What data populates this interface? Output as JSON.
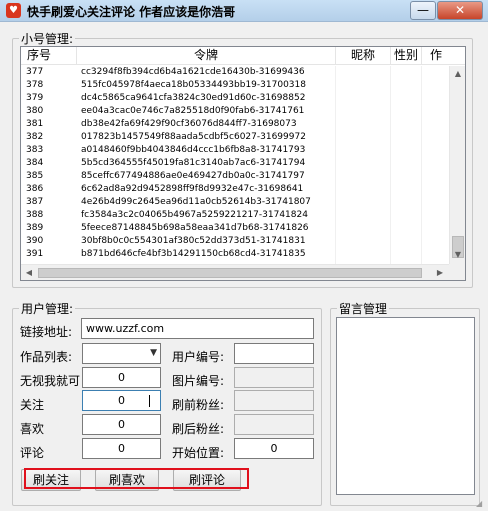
{
  "window": {
    "title": "快手刷爱心关注评论 作者应该是你浩哥",
    "minimize_glyph": "—",
    "close_glyph": "✕"
  },
  "accounts": {
    "group_title": "小号管理:",
    "columns": [
      "序号",
      "令牌",
      "昵称",
      "性别",
      "作"
    ],
    "rows": [
      {
        "id": "377",
        "token": "cc3294f8fb394cd6b4a1621cde16430b-31699436"
      },
      {
        "id": "378",
        "token": "515fc045978f4aeca18b05334493bb19-31700318"
      },
      {
        "id": "379",
        "token": "dc4c5865ca9641cfa3824c30ed91d60c-31698852"
      },
      {
        "id": "380",
        "token": "ee04a3cac0e746c7a825518d0f90fab6-31741761"
      },
      {
        "id": "381",
        "token": "db38e42fa69f429f90cf36076d844ff7-31698073"
      },
      {
        "id": "382",
        "token": "017823b1457549f88aada5cdbf5c6027-31699972"
      },
      {
        "id": "383",
        "token": "a0148460f9bb4043846d4ccc1b6fb8a8-31741793"
      },
      {
        "id": "384",
        "token": "5b5cd364555f45019fa81c3140ab7ac6-31741794"
      },
      {
        "id": "385",
        "token": "85ceffc677494886ae0e469427db0a0c-31741797"
      },
      {
        "id": "386",
        "token": "6c62ad8a92d9452898ff9f8d9932e47c-31698641"
      },
      {
        "id": "387",
        "token": "4e26b4d99c2645ea96d11a0cb52614b3-31741807"
      },
      {
        "id": "388",
        "token": "fc3584a3c2c04065b4967a5259221217-31741824"
      },
      {
        "id": "389",
        "token": "5feece87148845b698a58eaa341d7b68-31741826"
      },
      {
        "id": "390",
        "token": "30bf8b0c0c554301af380c52dd373d51-31741831"
      },
      {
        "id": "391",
        "token": "b871bd646cfe4bf3b14291150cb68cd4-31741835"
      }
    ]
  },
  "users": {
    "group_title": "用户管理:",
    "url_label": "链接地址:",
    "url_value": "www.uzzf.com",
    "works_label": "作品列表:",
    "user_no_label": "用户编号:",
    "ignore_label": "无视我就可",
    "ignore_value": "0",
    "pic_no_label": "图片编号:",
    "follow_label": "关注",
    "follow_value": "0",
    "fans_before_label": "刷前粉丝:",
    "like_label": "喜欢",
    "like_value": "0",
    "fans_after_label": "刷后粉丝:",
    "comment_label": "评论",
    "comment_value": "0",
    "start_label": "开始位置:",
    "start_value": "0",
    "buttons": {
      "follow": "刷关注",
      "like": "刷喜欢",
      "comment": "刷评论"
    }
  },
  "messages": {
    "group_title": "留言管理"
  }
}
